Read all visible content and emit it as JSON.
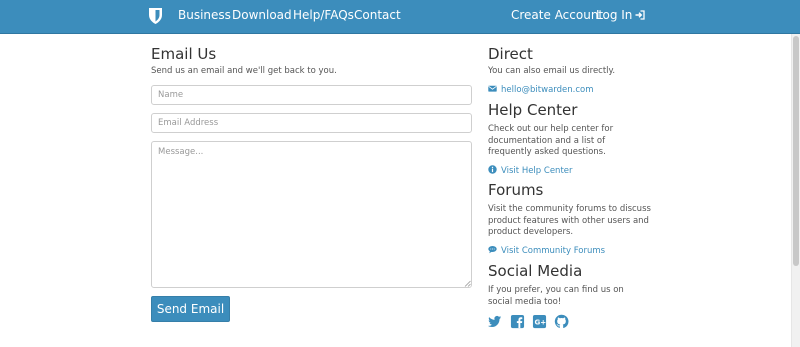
{
  "navbar": {
    "links": {
      "business": "Business",
      "download": "Download",
      "help": "Help/FAQs",
      "contact": "Contact",
      "create_account": "Create Account",
      "login": "Log In"
    },
    "colors": {
      "bar": "#3c8dbc",
      "text": "#ffffff"
    }
  },
  "email_us": {
    "title": "Email Us",
    "description": "Send us an email and we'll get back to you.",
    "name_placeholder": "Name",
    "email_placeholder": "Email Address",
    "message_placeholder": "Message...",
    "send_label": "Send Email"
  },
  "direct": {
    "title": "Direct",
    "description": "You can also email us directly.",
    "email_link": "hello@bitwarden.com",
    "icon": "envelope-icon"
  },
  "help_center": {
    "title": "Help Center",
    "description": "Check out our help center for documentation and a list of frequently asked questions.",
    "link": "Visit Help Center",
    "icon": "info-circle-icon"
  },
  "forums": {
    "title": "Forums",
    "description": "Visit the community forums to discuss product features with other users and product developers.",
    "link": "Visit Community Forums",
    "icon": "comment-icon"
  },
  "social_media": {
    "title": "Social Media",
    "description": "If you prefer, you can find us on social media too!",
    "icons": [
      "twitter-icon",
      "facebook-icon",
      "google-plus-icon",
      "github-icon"
    ]
  },
  "accent_color": "#3c8dbc"
}
